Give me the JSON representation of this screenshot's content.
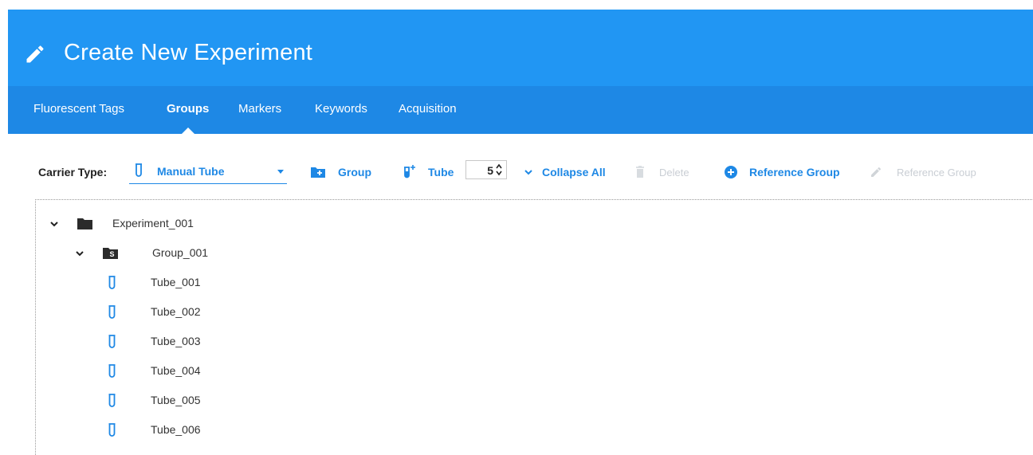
{
  "header": {
    "title": "Create New Experiment",
    "icon": "pencil-icon"
  },
  "tabs": [
    {
      "label": "Fluorescent Tags",
      "active": false
    },
    {
      "label": "Groups",
      "active": true
    },
    {
      "label": "Markers",
      "active": false
    },
    {
      "label": "Keywords",
      "active": false
    },
    {
      "label": "Acquisition",
      "active": false
    }
  ],
  "toolbar": {
    "carrier_label": "Carrier Type:",
    "carrier_value": "Manual Tube",
    "group_label": "Group",
    "tube_label": "Tube",
    "tube_count": "5",
    "collapse_label": "Collapse All",
    "delete_label": "Delete",
    "reference_group_label": "Reference Group",
    "edit_reference_group_label": "Reference Group"
  },
  "tree": {
    "experiment": "Experiment_001",
    "group": "Group_001",
    "group_badge": "S",
    "tubes": [
      "Tube_001",
      "Tube_002",
      "Tube_003",
      "Tube_004",
      "Tube_005",
      "Tube_006"
    ]
  },
  "colors": {
    "header": "#2196f3",
    "tabbar": "#1e88e5",
    "accent": "#1e88e5",
    "disabled": "#c9ced4"
  }
}
